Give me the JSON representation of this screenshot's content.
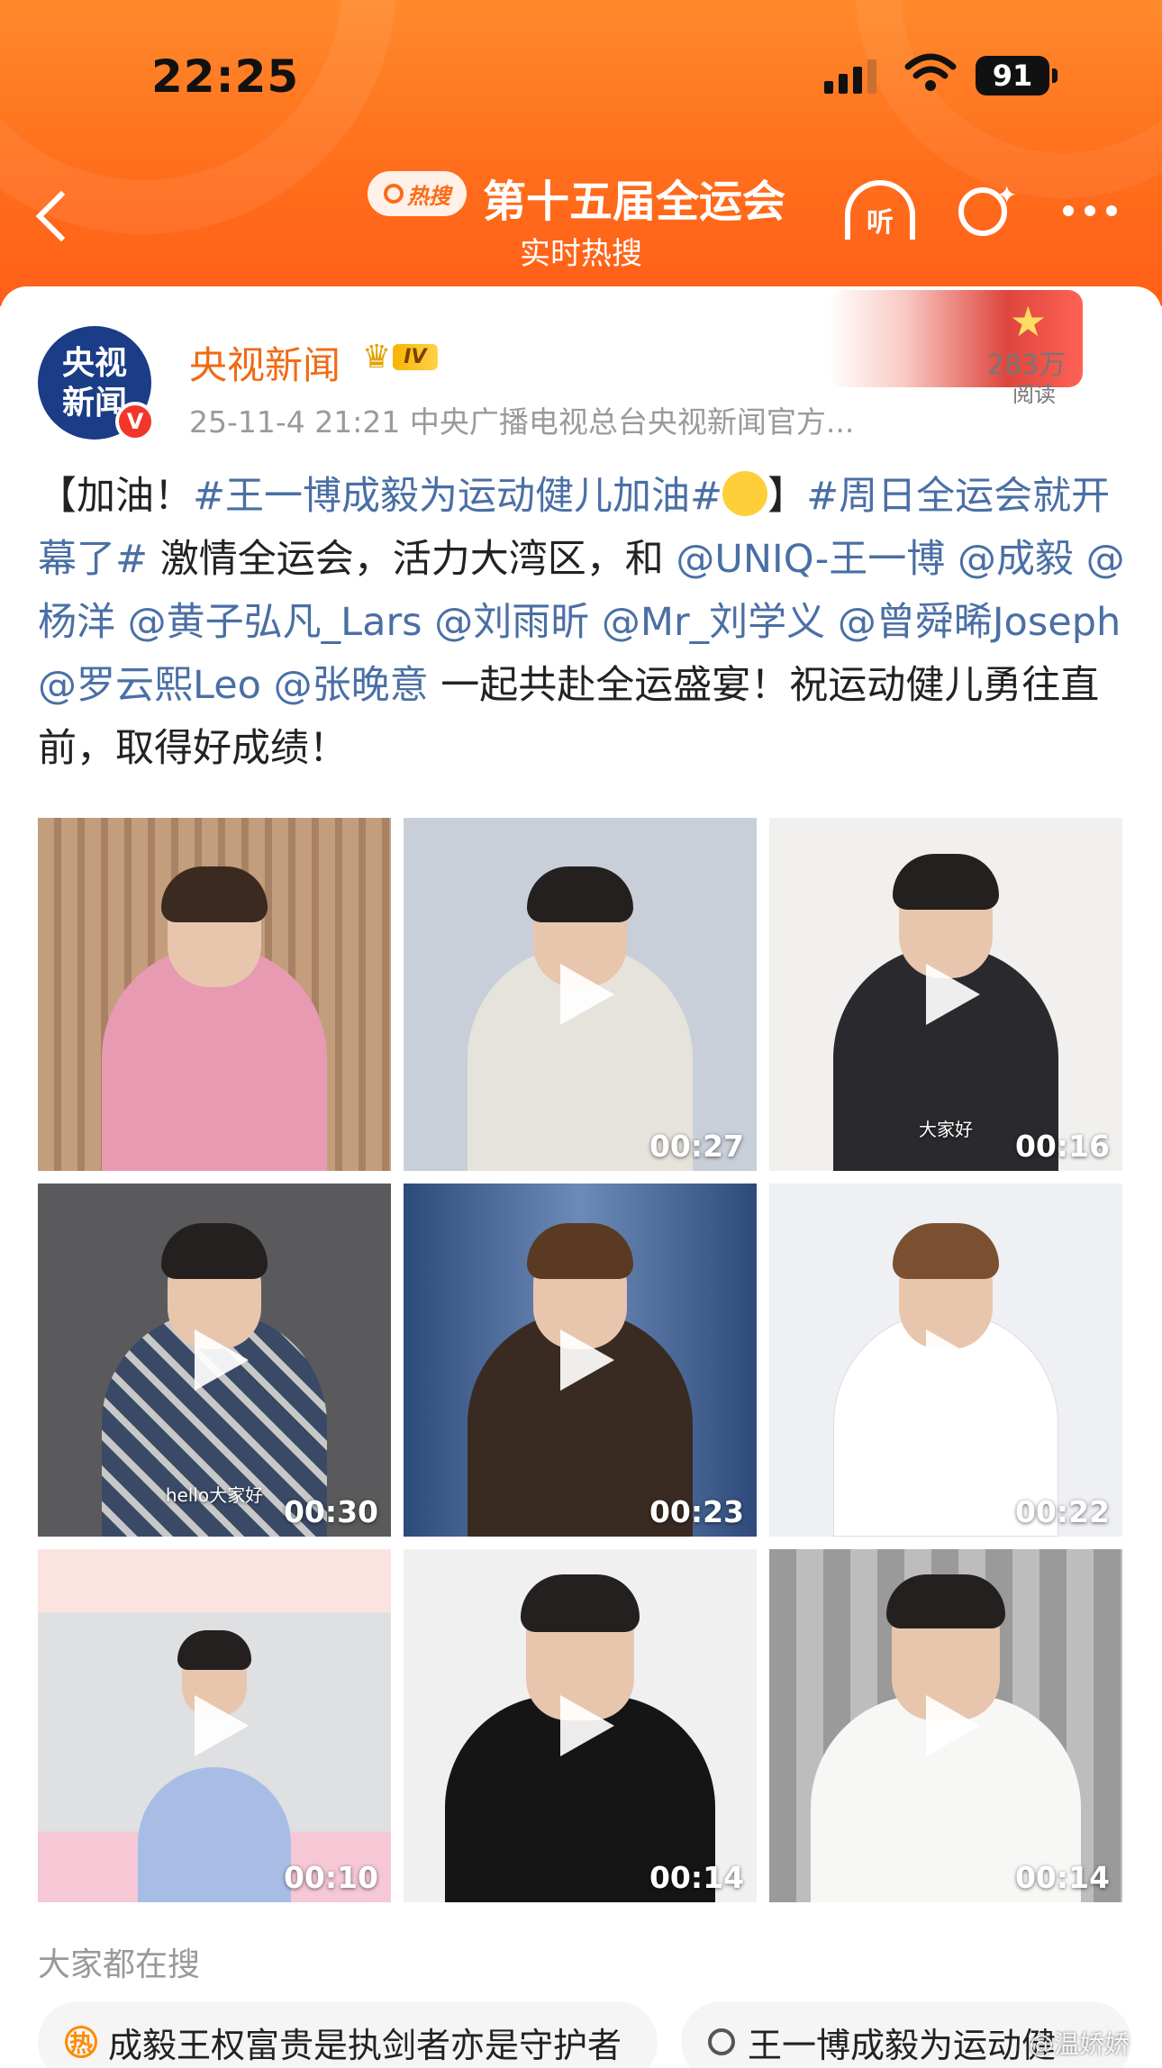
{
  "status_bar": {
    "time": "22:25",
    "battery": "91"
  },
  "header": {
    "badge": "热搜",
    "title": "第十五届全运会",
    "subtitle": "实时热搜",
    "listen_label": "听"
  },
  "post": {
    "author": {
      "avatar_line1": "央视",
      "avatar_line2": "新闻",
      "name": "央视新闻",
      "level_badge": "IV",
      "verified_mark": "V"
    },
    "meta": "25-11-4 21:21  中央广播电视总台央视新闻官方...",
    "reads": {
      "count": "283万",
      "label": "阅读"
    },
    "text": {
      "p1": "【加油！",
      "tag1": "#王一博成毅为运动健儿加油#",
      "p2": "】",
      "tag2": "#周日全运会就开幕了#",
      "p3": " 激情全运会，活力大湾区，和 ",
      "mentions": [
        "@UNIQ-王一博",
        "@成毅",
        "@杨洋",
        "@黄子弘凡_Lars",
        "@刘雨昕",
        "@Mr_刘学义",
        "@曾舜晞Joseph",
        "@罗云熙Leo",
        "@张晚意"
      ],
      "p4": " 一起共赴全运盛宴！祝运动健儿勇往直前，取得好成绩！"
    },
    "videos": [
      {
        "duration": "",
        "caption": ""
      },
      {
        "duration": "00:27",
        "caption": ""
      },
      {
        "duration": "00:16",
        "caption": "大家好"
      },
      {
        "duration": "00:30",
        "caption": "hello大家好"
      },
      {
        "duration": "00:23",
        "caption": ""
      },
      {
        "duration": "00:22",
        "caption": ""
      },
      {
        "duration": "00:10",
        "caption": ""
      },
      {
        "duration": "00:14",
        "caption": ""
      },
      {
        "duration": "00:14",
        "caption": ""
      }
    ]
  },
  "trending": {
    "label": "大家都在搜",
    "items": [
      {
        "hot_mark": "热",
        "text": "成毅王权富贵是执剑者亦是守护者"
      },
      {
        "text": "王一博成毅为运动健"
      }
    ],
    "watermark": "@温娇娇"
  },
  "colors": {
    "accent": "#ff6a17",
    "link": "#4a6fa5",
    "author": "#f06a14"
  }
}
